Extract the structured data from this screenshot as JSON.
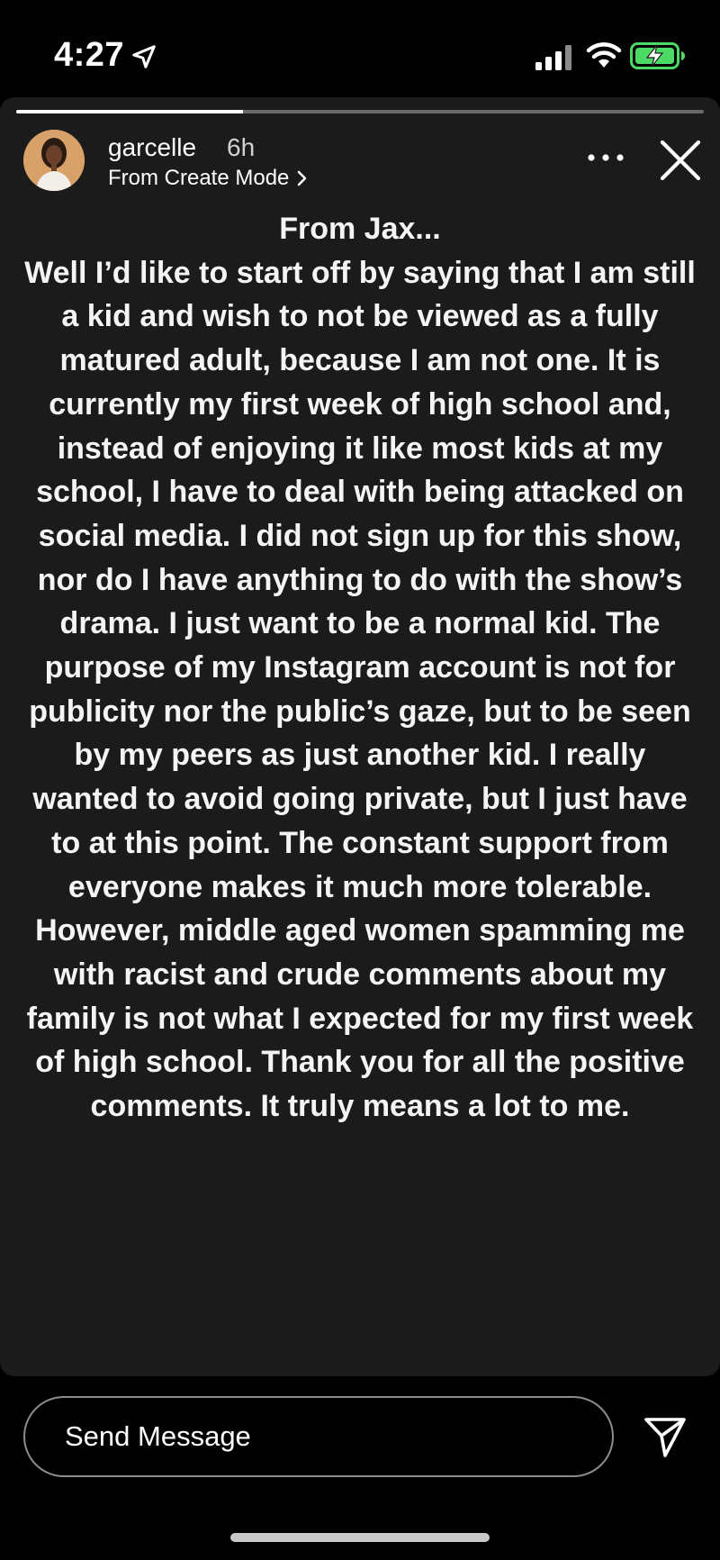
{
  "status_bar": {
    "time": "4:27",
    "icons": [
      "location-arrow-icon",
      "cellular-signal-icon",
      "wifi-icon",
      "battery-charging-icon"
    ],
    "battery_color": "#4cd964"
  },
  "story": {
    "progress": 0.33,
    "author": {
      "username": "garcelle",
      "time_ago": "6h",
      "subtitle": "From Create Mode",
      "avatar_icon": "profile-avatar"
    },
    "title": "From Jax...",
    "body": "Well I’d like to start off by saying that I am still a kid and wish to not be viewed as a fully matured adult, because I am not one. It is currently my first week of high school and, instead of enjoying it like most kids at my school, I have to deal with being attacked on social media. I did not sign up for this show, nor do I have anything to do with the show’s drama. I just want to be a normal kid. The purpose of my Instagram account is not for publicity nor the public’s gaze, but to be seen by my peers as just another kid. I really wanted to avoid going private, but I just have to at this point. The constant support from everyone makes it much more tolerable. However, middle aged women spamming me with racist and crude comments about my family is not what I expected for my first week of high school. Thank you for all the positive comments. It truly means a lot to me."
  },
  "controls": {
    "more_icon": "more-horizontal-icon",
    "close_icon": "close-icon",
    "send_icon": "send-paper-plane-icon"
  },
  "reply": {
    "placeholder": "Send Message"
  },
  "colors": {
    "background": "#000000",
    "card": "#1b1b1b",
    "text": "#ffffff"
  }
}
